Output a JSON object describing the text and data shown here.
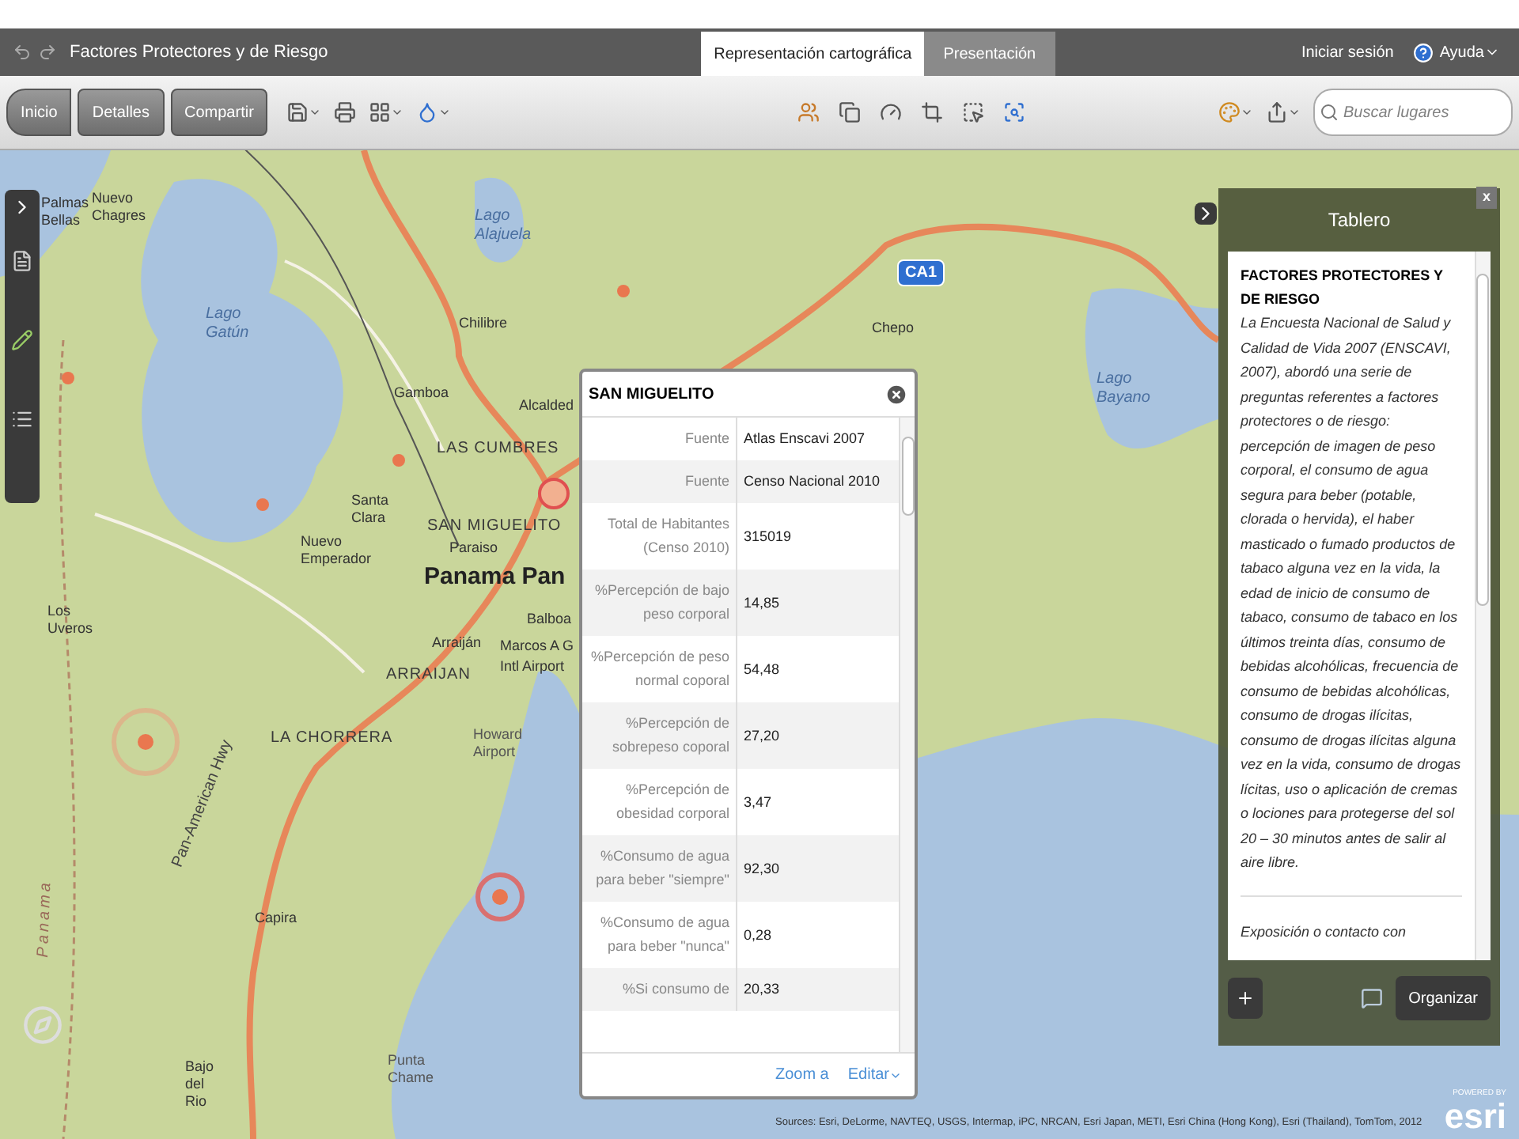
{
  "window": {
    "title": "Factores Protectores y de Riesgo"
  },
  "tabs": [
    {
      "label": "Representación cartográfica",
      "selected": true
    },
    {
      "label": "Presentación",
      "selected": false
    }
  ],
  "header_links": [
    "Iniciar sesión",
    "Ayuda"
  ],
  "toolbar": {
    "buttons": [
      "Inicio",
      "Detalles",
      "Compartir"
    ],
    "search": {
      "placeholder": "Buscar lugares"
    }
  },
  "map": {
    "labels": [
      {
        "text": "Palmas Bellas",
        "kind": "town"
      },
      {
        "text": "Nuevo Chagres",
        "kind": "town"
      },
      {
        "text": "Lago Gatún",
        "kind": "water"
      },
      {
        "text": "Lago Alajuela",
        "kind": "water"
      },
      {
        "text": "Chilibre",
        "kind": "town"
      },
      {
        "text": "Gamboa",
        "kind": "town"
      },
      {
        "text": "Alcalded",
        "kind": "town"
      },
      {
        "text": "LAS CUMBRES",
        "kind": "district"
      },
      {
        "text": "Santa Clara",
        "kind": "town"
      },
      {
        "text": "SAN MIGUELITO",
        "kind": "district"
      },
      {
        "text": "Paraiso",
        "kind": "town"
      },
      {
        "text": "Nuevo Emperador",
        "kind": "town"
      },
      {
        "text": "Panama Pan",
        "kind": "city"
      },
      {
        "text": "Balboa",
        "kind": "town"
      },
      {
        "text": "Marcos A G",
        "kind": "town"
      },
      {
        "text": "Intl Airport",
        "kind": "town"
      },
      {
        "text": "Arraiján",
        "kind": "town"
      },
      {
        "text": "ARRAIJAN",
        "kind": "district"
      },
      {
        "text": "LA CHORRERA",
        "kind": "district"
      },
      {
        "text": "Howard Airport",
        "kind": "faint"
      },
      {
        "text": "Los Uveros",
        "kind": "town"
      },
      {
        "text": "Pan-American Hwy",
        "kind": "road"
      },
      {
        "text": "Capira",
        "kind": "town"
      },
      {
        "text": "Panama",
        "kind": "border"
      },
      {
        "text": "Bajo del Rio",
        "kind": "town"
      },
      {
        "text": "Punta Chame",
        "kind": "faint"
      },
      {
        "text": "Chepo",
        "kind": "town"
      },
      {
        "text": "CA1",
        "kind": "shield"
      },
      {
        "text": "Lago Bayano",
        "kind": "water"
      }
    ],
    "attribution": "Sources: Esri, DeLorme, NAVTEQ, USGS, Intermap, iPC, NRCAN, Esri Japan, METI, Esri China (Hong Kong), Esri (Thailand), TomTom, 2012",
    "logo": {
      "caption": "POWERED BY",
      "name": "esri"
    }
  },
  "popup": {
    "title": "SAN MIGUELITO",
    "rows": [
      {
        "label": "Fuente",
        "value": "Atlas Enscavi 2007"
      },
      {
        "label": "Fuente",
        "value": "Censo Nacional 2010"
      },
      {
        "label": "Total de Habitantes (Censo 2010)",
        "value": "315019"
      },
      {
        "label": "%Percepción de bajo peso corporal",
        "value": "14,85"
      },
      {
        "label": "%Percepción de peso normal coporal",
        "value": "54,48"
      },
      {
        "label": "%Percepción de sobrepeso coporal",
        "value": "27,20"
      },
      {
        "label": "%Percepción de obesidad corporal",
        "value": "3,47"
      },
      {
        "label": "%Consumo de agua para beber \"siempre\"",
        "value": "92,30"
      },
      {
        "label": "%Consumo de agua para beber \"nunca\"",
        "value": "0,28"
      },
      {
        "label": "%Si consumo de",
        "value": "20,33"
      }
    ],
    "links": [
      "Zoom a",
      "Editar"
    ]
  },
  "panel": {
    "title": "Tablero",
    "heading": "FACTORES PROTECTORES Y DE RIESGO",
    "body": "La Encuesta Nacional de Salud y Calidad de Vida 2007 (ENSCAVI, 2007), abordó una serie de preguntas referentes a factores protectores o de riesgo: percepción de imagen de peso corporal, el consumo de agua segura para beber (potable, clorada o hervida), el haber masticado o fumado productos de tabaco alguna vez en la vida, la edad de inicio de consumo de tabaco, consumo de tabaco en los últimos treinta días, consumo de bebidas alcohólicas, frecuencia de consumo de bebidas alcohólicas, consumo de drogas ilícitas, consumo de drogas ilícitas alguna vez en la vida, consumo de drogas lícitas, uso o aplicación de cremas o lociones para protegerse del sol 20 – 30 minutos antes de salir al aire libre.",
    "next": "Exposición o contacto con",
    "close": "x",
    "button": "Organizar"
  }
}
